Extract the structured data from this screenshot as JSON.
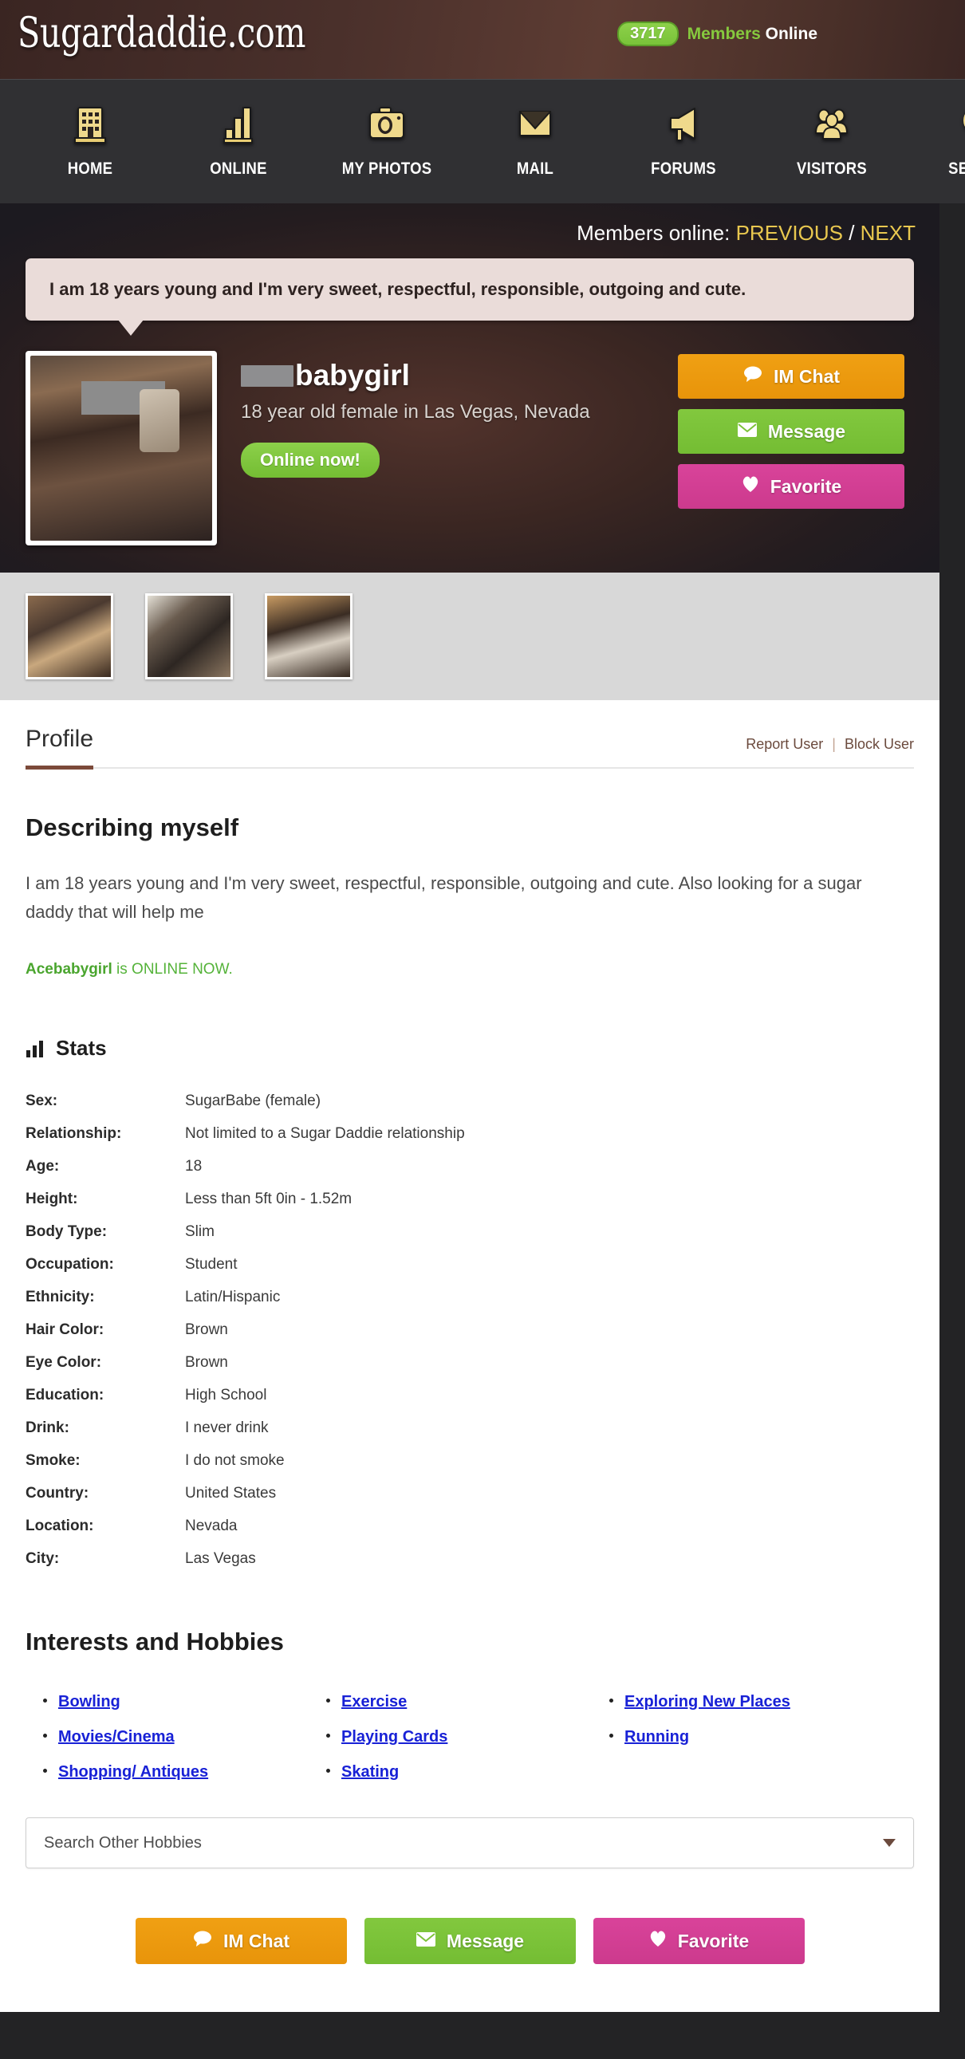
{
  "header": {
    "logo": "Sugardaddie.com",
    "online_count": "3717",
    "online_label_green": "Members",
    "online_label_white": "Online"
  },
  "nav": {
    "items": [
      {
        "label": "HOME",
        "icon": "building-icon"
      },
      {
        "label": "ONLINE",
        "icon": "bar-chart-icon"
      },
      {
        "label": "MY PHOTOS",
        "icon": "camera-icon"
      },
      {
        "label": "MAIL",
        "icon": "envelope-icon"
      },
      {
        "label": "FORUMS",
        "icon": "megaphone-icon"
      },
      {
        "label": "VISITORS",
        "icon": "people-icon"
      },
      {
        "label": "SEARCH",
        "icon": "magnifier-icon"
      }
    ]
  },
  "members_bar": {
    "label": "Members online:",
    "previous": "PREVIOUS",
    "separator": "/",
    "next": "NEXT"
  },
  "hero": {
    "quote": "I am 18 years young and I'm very sweet, respectful, responsible, outgoing and cute.",
    "username_suffix": "babygirl",
    "subtitle": "18 year old female in Las Vegas, Nevada",
    "online_badge": "Online now!",
    "actions": [
      {
        "label": "IM Chat",
        "icon": "chat-bubble-icon",
        "color": "#ef9d11"
      },
      {
        "label": "Message",
        "icon": "envelope-icon",
        "color": "#7cc239"
      },
      {
        "label": "Favorite",
        "icon": "heart-icon",
        "color": "#d43f95"
      }
    ]
  },
  "thumbnails": [
    {
      "alt": "profile photo 1"
    },
    {
      "alt": "profile photo 2"
    },
    {
      "alt": "profile photo 3"
    }
  ],
  "profile_tabs": {
    "active": "Profile",
    "report_user": "Report User",
    "pipe": "|",
    "block_user": "Block User"
  },
  "describing": {
    "title": "Describing myself",
    "body": "I am 18 years young and I'm very sweet, respectful, responsible, outgoing and cute. Also looking for a sugar daddy that will help me",
    "online_name": "Acebabygirl",
    "online_rest": " is ONLINE NOW."
  },
  "stats": {
    "title": "Stats",
    "rows": [
      {
        "key": "Sex:",
        "value": "SugarBabe (female)"
      },
      {
        "key": "Relationship:",
        "value": "Not limited to a Sugar Daddie relationship"
      },
      {
        "key": "Age:",
        "value": "18"
      },
      {
        "key": "Height:",
        "value": "Less than 5ft 0in - 1.52m"
      },
      {
        "key": "Body Type:",
        "value": "Slim"
      },
      {
        "key": "Occupation:",
        "value": "Student"
      },
      {
        "key": "Ethnicity:",
        "value": "Latin/Hispanic"
      },
      {
        "key": "Hair Color:",
        "value": "Brown"
      },
      {
        "key": "Eye Color:",
        "value": "Brown"
      },
      {
        "key": "Education:",
        "value": "High School"
      },
      {
        "key": "Drink:",
        "value": "I never drink"
      },
      {
        "key": "Smoke:",
        "value": "I do not smoke"
      },
      {
        "key": "Country:",
        "value": "United States"
      },
      {
        "key": "Location:",
        "value": "Nevada"
      },
      {
        "key": "City:",
        "value": "Las Vegas"
      }
    ]
  },
  "interests": {
    "title": "Interests and Hobbies",
    "items": [
      "Bowling",
      "Exercise",
      "Exploring New Places",
      "Movies/Cinema",
      "Playing Cards",
      "Running",
      "Shopping/ Antiques",
      "Skating"
    ],
    "select_placeholder": "Search Other Hobbies"
  },
  "bottom_actions": [
    {
      "label": "IM Chat",
      "icon": "chat-bubble-icon"
    },
    {
      "label": "Message",
      "icon": "envelope-icon"
    },
    {
      "label": "Favorite",
      "icon": "heart-icon"
    }
  ],
  "colors": {
    "brand_brown": "#5d3c33",
    "accent_green": "#7cc239",
    "accent_orange": "#ef9d11",
    "accent_pink": "#d43f95",
    "link_blue": "#1821d6",
    "gold": "#e9c84f"
  }
}
